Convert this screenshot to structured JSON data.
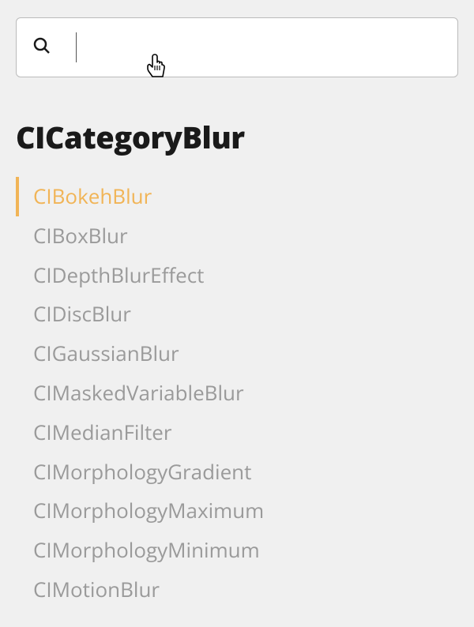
{
  "search": {
    "value": "",
    "placeholder": ""
  },
  "category": {
    "title": "CICategoryBlur"
  },
  "filters": [
    {
      "label": "CIBokehBlur",
      "active": true
    },
    {
      "label": "CIBoxBlur",
      "active": false
    },
    {
      "label": "CIDepthBlurEffect",
      "active": false
    },
    {
      "label": "CIDiscBlur",
      "active": false
    },
    {
      "label": "CIGaussianBlur",
      "active": false
    },
    {
      "label": "CIMaskedVariableBlur",
      "active": false
    },
    {
      "label": "CIMedianFilter",
      "active": false
    },
    {
      "label": "CIMorphologyGradient",
      "active": false
    },
    {
      "label": "CIMorphologyMaximum",
      "active": false
    },
    {
      "label": "CIMorphologyMinimum",
      "active": false
    },
    {
      "label": "CIMotionBlur",
      "active": false
    }
  ],
  "cursor": {
    "type": "pointer"
  }
}
